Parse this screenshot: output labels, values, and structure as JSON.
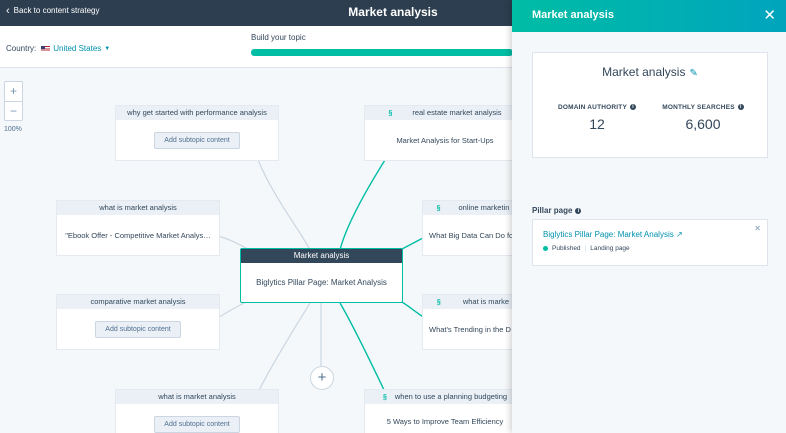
{
  "topbar": {
    "back_label": "Back to content strategy",
    "title": "Market analysis"
  },
  "subbar": {
    "country_label": "Country:",
    "country_value": "United States",
    "build_label": "Build your topic",
    "progress": 1.0
  },
  "zoom": {
    "plus": "+",
    "minus": "−",
    "level": "100%"
  },
  "pillar": {
    "topic": "Market analysis",
    "page": "Biglytics Pillar Page: Market Analysis"
  },
  "subtopics": [
    {
      "keyword": "why get started with performance analysis",
      "action": "Add subtopic content"
    },
    {
      "keyword": "real estate market analysis",
      "content": "Market Analysis for Start-Ups"
    },
    {
      "keyword": "what is market analysis",
      "content": "\"Ebook Offer - Competitive Market Analys…"
    },
    {
      "keyword": "online marketin",
      "content": "What Big Data Can Do fo"
    },
    {
      "keyword": "comparative market analysis",
      "action": "Add subtopic content"
    },
    {
      "keyword": "what is marke",
      "content": "What's Trending in the D"
    },
    {
      "keyword": "what is market analysis",
      "action": "Add subtopic content"
    },
    {
      "keyword": "when to use a planning budgeting",
      "content": "5 Ways to Improve Team Efficiency"
    }
  ],
  "add_icon": "plus-icon",
  "panel": {
    "title": "Market analysis",
    "close": "✕",
    "topic": "Market analysis",
    "domain_authority_label": "DOMAIN AUTHORITY",
    "domain_authority": "12",
    "monthly_searches_label": "MONTHLY SEARCHES",
    "monthly_searches": "6,600",
    "pillar_label": "Pillar page",
    "pillar_link": "Biglytics Pillar Page: Market Analysis",
    "status": "Published",
    "page_type": "Landing page"
  },
  "colors": {
    "accent": "#00bda5",
    "link": "#0091ae",
    "dark": "#2d3e50"
  }
}
